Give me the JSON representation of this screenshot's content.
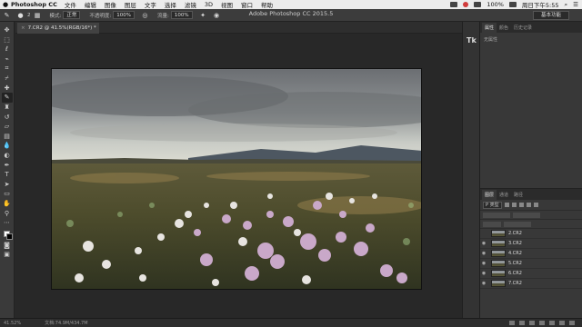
{
  "menubar": {
    "app_name": "Photoshop CC",
    "items": [
      "文件",
      "编辑",
      "图像",
      "图层",
      "文字",
      "选择",
      "滤镜",
      "3D",
      "视图",
      "窗口",
      "帮助"
    ],
    "battery": "100%",
    "clock": "周日下午5:55"
  },
  "options": {
    "brush_size": "2",
    "mode_label": "模式:",
    "mode_value": "正常",
    "opacity_label": "不透明度:",
    "opacity_value": "100%",
    "flow_label": "流量:",
    "flow_value": "100%",
    "window_title": "Adobe Photoshop CC 2015.5",
    "workspace": "基本功能"
  },
  "document": {
    "tab_label": "7.CR2 @ 41.5%(RGB/16*) *"
  },
  "status": {
    "zoom": "41.52%",
    "doc_info": "文档:74.9M/434.7M"
  },
  "dock": {
    "tk_label": "Tk"
  },
  "top_panel": {
    "tabs": [
      "属性",
      "颜色",
      "历史记录"
    ],
    "active_tab": "属性",
    "hint": "无属性"
  },
  "layers_panel": {
    "tabs": [
      "图层",
      "通道",
      "路径"
    ],
    "active_tab": "图层",
    "kind_filter": "P 类型",
    "layers": [
      {
        "name": "2.CR2",
        "visible": false
      },
      {
        "name": "3.CR2",
        "visible": true
      },
      {
        "name": "4.CR2",
        "visible": true
      },
      {
        "name": "5.CR2",
        "visible": true
      },
      {
        "name": "6.CR2",
        "visible": true
      },
      {
        "name": "7.CR2",
        "visible": true
      }
    ]
  },
  "tools": [
    "move-tool",
    "marquee-tool",
    "lasso-tool",
    "quick-select-tool",
    "crop-tool",
    "eyedropper-tool",
    "healing-tool",
    "brush-tool",
    "stamp-tool",
    "history-brush-tool",
    "eraser-tool",
    "gradient-tool",
    "blur-tool",
    "dodge-tool",
    "pen-tool",
    "type-tool",
    "path-select-tool",
    "shape-tool",
    "hand-tool",
    "zoom-tool"
  ],
  "colors": {
    "foreground": "#ffffff",
    "background": "#000000",
    "ui_dark": "#282828"
  }
}
